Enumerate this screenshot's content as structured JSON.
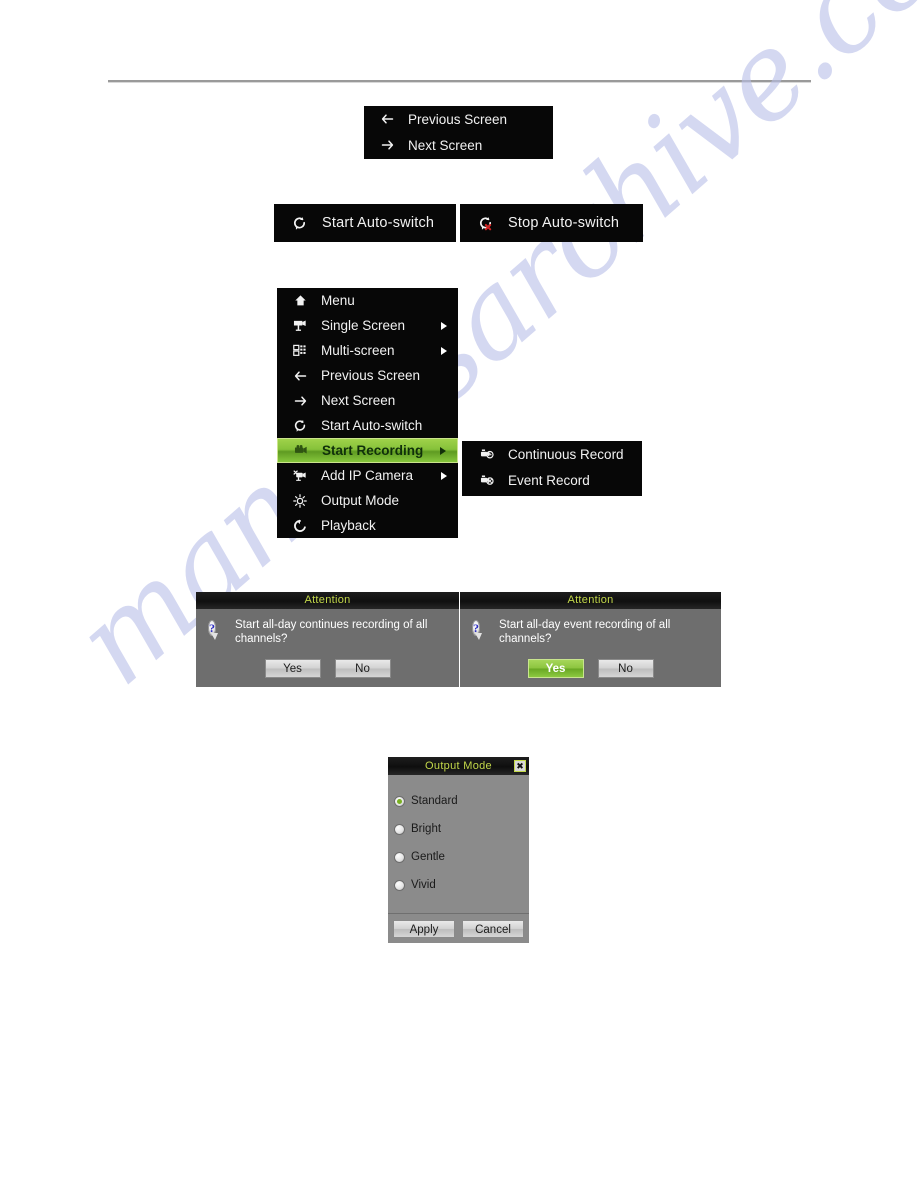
{
  "page": {
    "watermark_text": "manualsarchive.com"
  },
  "prev_next_panel": {
    "items": [
      {
        "label": "Previous Screen",
        "icon": "arrow-left-icon"
      },
      {
        "label": "Next Screen",
        "icon": "arrow-right-icon"
      }
    ]
  },
  "autoswitch": {
    "start": {
      "label": "Start Auto-switch",
      "icon": "refresh-icon"
    },
    "stop": {
      "label": "Stop Auto-switch",
      "icon": "refresh-stop-icon"
    }
  },
  "context_menu": {
    "items": [
      {
        "label": "Menu",
        "icon": "home-icon",
        "arrow": false,
        "highlighted": false
      },
      {
        "label": "Single Screen",
        "icon": "camera-icon",
        "arrow": true,
        "highlighted": false
      },
      {
        "label": "Multi-screen",
        "icon": "grid-icon",
        "arrow": true,
        "highlighted": false
      },
      {
        "label": "Previous Screen",
        "icon": "arrow-left-icon",
        "arrow": false,
        "highlighted": false
      },
      {
        "label": "Next Screen",
        "icon": "arrow-right-icon",
        "arrow": false,
        "highlighted": false
      },
      {
        "label": "Start Auto-switch",
        "icon": "refresh-icon",
        "arrow": false,
        "highlighted": false
      },
      {
        "label": "Start Recording",
        "icon": "record-icon",
        "arrow": true,
        "highlighted": true
      },
      {
        "label": "Add IP Camera",
        "icon": "ip-camera-icon",
        "arrow": true,
        "highlighted": false
      },
      {
        "label": "Output Mode",
        "icon": "brightness-icon",
        "arrow": false,
        "highlighted": false
      },
      {
        "label": "Playback",
        "icon": "playback-icon",
        "arrow": false,
        "highlighted": false
      }
    ]
  },
  "record_submenu": {
    "items": [
      {
        "label": "Continuous Record",
        "icon": "continuous-record-icon"
      },
      {
        "label": "Event Record",
        "icon": "event-record-icon"
      }
    ]
  },
  "dialog_continuous": {
    "title": "Attention",
    "icon": "question-icon",
    "message": "Start all-day continues recording of all channels?",
    "yes_label": "Yes",
    "no_label": "No",
    "focused_button": "none"
  },
  "dialog_event": {
    "title": "Attention",
    "icon": "question-icon",
    "message": "Start all-day event recording of all channels?",
    "yes_label": "Yes",
    "no_label": "No",
    "focused_button": "Yes"
  },
  "output_mode_dialog": {
    "title": "Output Mode",
    "close_label": "✖",
    "options": [
      {
        "label": "Standard",
        "selected": true
      },
      {
        "label": "Bright",
        "selected": false
      },
      {
        "label": "Gentle",
        "selected": false
      },
      {
        "label": "Vivid",
        "selected": false
      }
    ],
    "apply_label": "Apply",
    "cancel_label": "Cancel"
  },
  "colors": {
    "accent_green": "#8cc53f",
    "title_text": "#c3d84a",
    "panel_black": "#070707",
    "dialog_gray": "#6e6e6e",
    "watermark": "#b9bfe8",
    "stop_red": "#cc2222"
  }
}
